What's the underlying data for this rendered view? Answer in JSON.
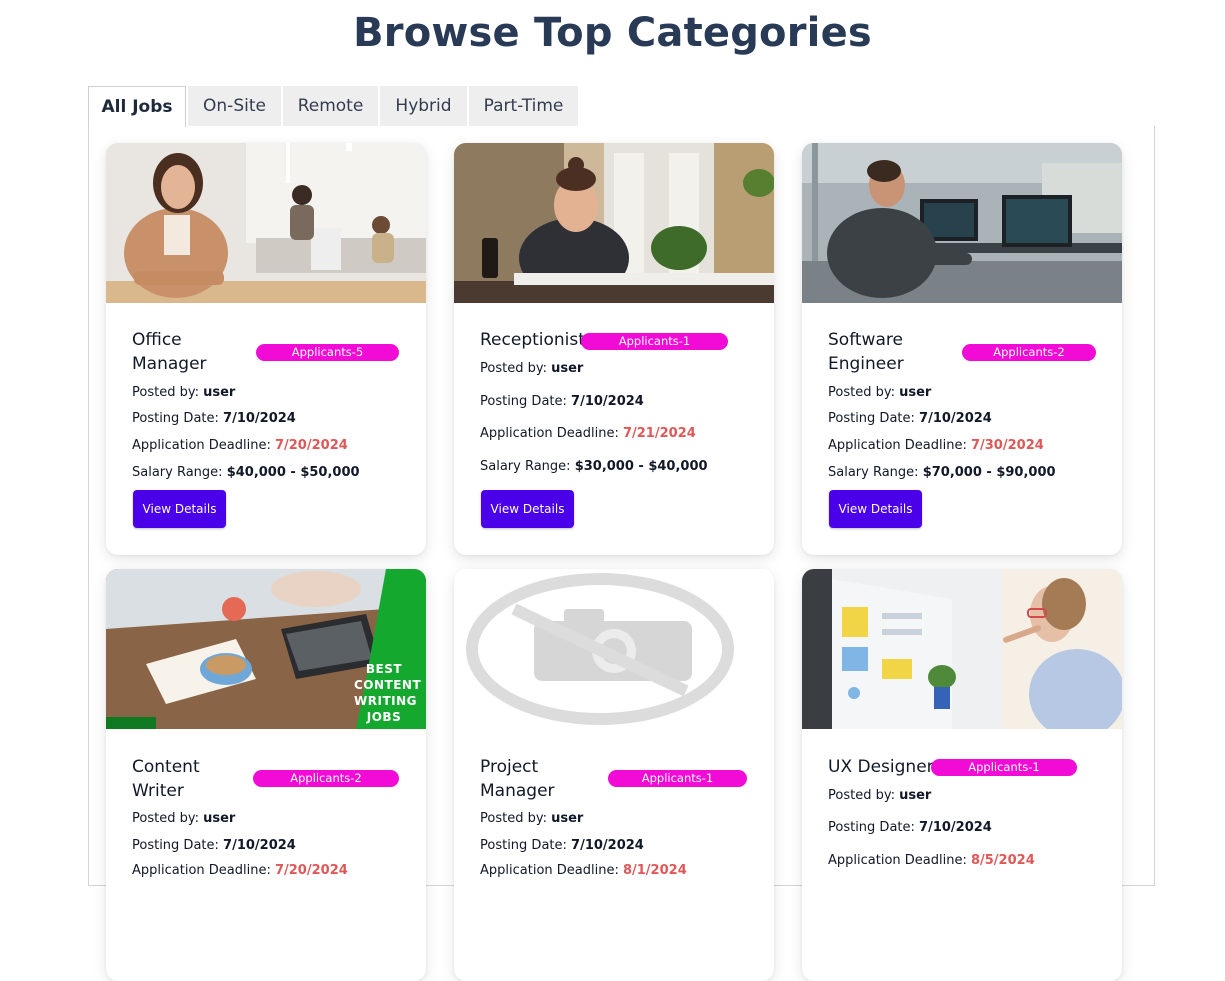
{
  "page": {
    "title": "Browse Top Categories"
  },
  "tabs": [
    {
      "label": "All Jobs"
    },
    {
      "label": "On-Site"
    },
    {
      "label": "Remote"
    },
    {
      "label": "Hybrid"
    },
    {
      "label": "Part-Time"
    }
  ],
  "labels": {
    "posted_by": "Posted by: ",
    "posting_date": "Posting Date: ",
    "deadline": "Application Deadline: ",
    "salary": "Salary Range: ",
    "view_details": "View Details"
  },
  "jobs": [
    {
      "title": "Office Manager",
      "applicants": "Applicants-5",
      "posted_by": "user",
      "posting_date": "7/10/2024",
      "deadline": "7/20/2024",
      "salary": "$40,000 - $50,000",
      "image": "office-manager-photo"
    },
    {
      "title": "Receptionist",
      "applicants": "Applicants-1",
      "posted_by": "user",
      "posting_date": "7/10/2024",
      "deadline": "7/21/2024",
      "salary": "$30,000 - $40,000",
      "image": "receptionist-photo"
    },
    {
      "title": "Software Engineer",
      "applicants": "Applicants-2",
      "posted_by": "user",
      "posting_date": "7/10/2024",
      "deadline": "7/30/2024",
      "salary": "$70,000 - $90,000",
      "image": "software-engineer-photo"
    },
    {
      "title": "Content Writer",
      "applicants": "Applicants-2",
      "posted_by": "user",
      "posting_date": "7/10/2024",
      "deadline": "7/20/2024",
      "salary": "",
      "image": "content-writing-banner",
      "image_text": "BEST CONTENT WRITING JOBS"
    },
    {
      "title": "Project Manager",
      "applicants": "Applicants-1",
      "posted_by": "user",
      "posting_date": "7/10/2024",
      "deadline": "8/1/2024",
      "salary": "",
      "image": "no-photo-placeholder-icon"
    },
    {
      "title": "UX Designer",
      "applicants": "Applicants-1",
      "posted_by": "user",
      "posting_date": "7/10/2024",
      "deadline": "8/5/2024",
      "salary": "",
      "image": "ux-designer-photo"
    }
  ],
  "colors": {
    "title": "#283a56",
    "badge": "#f20ad6",
    "button": "#4a00e8",
    "deadline": "#e05757"
  }
}
